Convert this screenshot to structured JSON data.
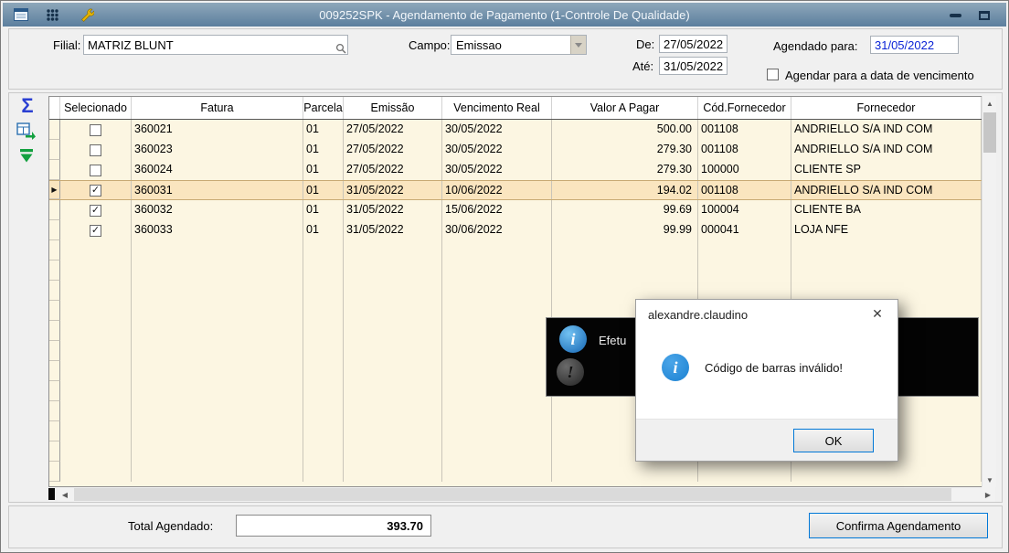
{
  "window": {
    "title": "009252SPK - Agendamento de Pagamento (1-Controle De Qualidade)"
  },
  "filters": {
    "filial_label": "Filial:",
    "filial_value": "MATRIZ BLUNT",
    "campo_label": "Campo:",
    "campo_value": "Emissao",
    "de_label": "De:",
    "de_value": "27/05/2022",
    "ate_label": "Até:",
    "ate_value": "31/05/2022",
    "agendado_label": "Agendado para:",
    "agendado_value": "31/05/2022",
    "agendar_vencimento_label": "Agendar para a data de vencimento",
    "agendar_vencimento_checked": false
  },
  "side_toolbar": {
    "sum_icon": "Σ"
  },
  "table": {
    "columns": [
      "Selecionado",
      "Fatura",
      "Parcela",
      "Emissão",
      "Vencimento Real",
      "Valor A Pagar",
      "Cód.Fornecedor",
      "Fornecedor"
    ],
    "rows": [
      {
        "selected": false,
        "fatura": "360021",
        "parcela": "01",
        "emissao": "27/05/2022",
        "vencimento": "30/05/2022",
        "valor": "500.00",
        "cod": "001108",
        "fornecedor": "ANDRIELLO S/A IND COM",
        "highlighted": false
      },
      {
        "selected": false,
        "fatura": "360023",
        "parcela": "01",
        "emissao": "27/05/2022",
        "vencimento": "30/05/2022",
        "valor": "279.30",
        "cod": "001108",
        "fornecedor": "ANDRIELLO S/A IND COM",
        "highlighted": false
      },
      {
        "selected": false,
        "fatura": "360024",
        "parcela": "01",
        "emissao": "27/05/2022",
        "vencimento": "30/05/2022",
        "valor": "279.30",
        "cod": "100000",
        "fornecedor": "CLIENTE SP",
        "highlighted": false
      },
      {
        "selected": true,
        "fatura": "360031",
        "parcela": "01",
        "emissao": "31/05/2022",
        "vencimento": "10/06/2022",
        "valor": "194.02",
        "cod": "001108",
        "fornecedor": "ANDRIELLO S/A IND COM",
        "highlighted": true
      },
      {
        "selected": true,
        "fatura": "360032",
        "parcela": "01",
        "emissao": "31/05/2022",
        "vencimento": "15/06/2022",
        "valor": "99.69",
        "cod": "100004",
        "fornecedor": "CLIENTE BA",
        "highlighted": false
      },
      {
        "selected": true,
        "fatura": "360033",
        "parcela": "01",
        "emissao": "31/05/2022",
        "vencimento": "30/06/2022",
        "valor": "99.99",
        "cod": "000041",
        "fornecedor": "LOJA NFE",
        "highlighted": false
      }
    ]
  },
  "background_dialog": {
    "visible_text": "Efetu"
  },
  "dialog": {
    "title": "alexandre.claudino",
    "close": "✕",
    "icon_letter": "i",
    "message": "Código de barras inválido!",
    "ok_label": "OK"
  },
  "footer": {
    "total_label": "Total Agendado:",
    "total_value": "393.70",
    "confirm_label": "Confirma Agendamento"
  },
  "colors": {
    "titlebar-top": "#8ea7ba",
    "titlebar-bottom": "#5c7f9e",
    "grid-bg": "#fcf6e2",
    "grid-line": "#c9c5b9",
    "highlight-bg": "#fae5bf",
    "highlight-border": "#c8aa74",
    "accent-blue": "#0078d7",
    "info-blue": "#1b81d2",
    "date-blue": "#0a23d6",
    "icon-green": "#13a03f",
    "sigma-blue": "#2a3fd2"
  }
}
